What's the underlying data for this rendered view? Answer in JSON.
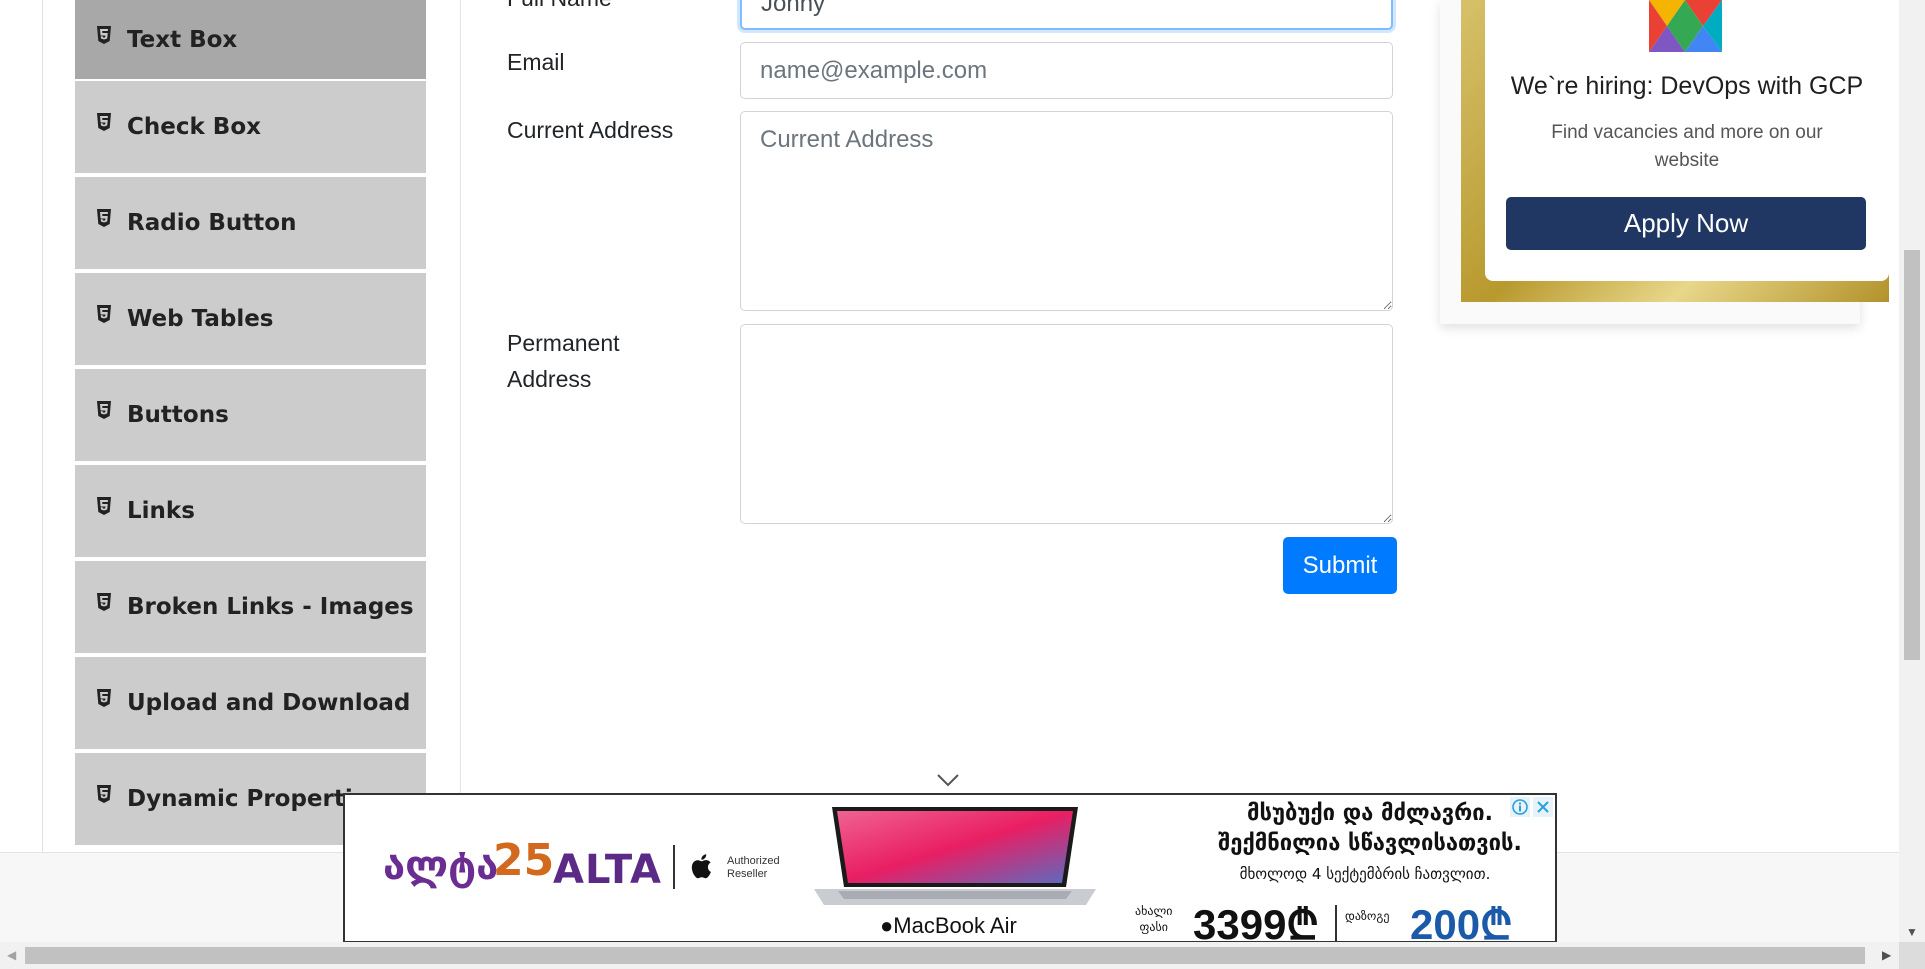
{
  "sidebar": {
    "items": [
      {
        "label": "Text Box",
        "active": true
      },
      {
        "label": "Check Box"
      },
      {
        "label": "Radio Button"
      },
      {
        "label": "Web Tables"
      },
      {
        "label": "Buttons"
      },
      {
        "label": "Links"
      },
      {
        "label": "Broken Links - Images"
      },
      {
        "label": "Upload and Download"
      },
      {
        "label": "Dynamic Properties"
      }
    ]
  },
  "form": {
    "full_name": {
      "label": "Full Name",
      "value": "Johny"
    },
    "email": {
      "label": "Email",
      "placeholder": "name@example.com"
    },
    "current_address": {
      "label": "Current Address",
      "placeholder": "Current Address"
    },
    "permanent_address": {
      "label_line1": "Permanent",
      "label_line2": "Address"
    },
    "submit_label": "Submit"
  },
  "ad_card": {
    "title": "We`re hiring: DevOps with GCP",
    "subtitle": "Find vacancies and more on our website",
    "button": "Apply Now"
  },
  "banner": {
    "brand_geo": "ალტა",
    "brand_25": "25",
    "brand_alta": "ALTA",
    "authorized": "Authorized",
    "reseller": "Reseller",
    "product": "MacBook Air",
    "headline_line1": "მსუბუქი და მძლავრი.",
    "headline_line2": "შექმნილია სწავლისათვის.",
    "note": "მხოლოდ 4 სექტემბრის ჩათვლით.",
    "new_price_line1": "ახალი",
    "new_price_line2": "ფასი",
    "price": "3399₾",
    "savings_label": "დაზოგე",
    "savings": "200₾"
  },
  "colors": {
    "primary": "#007bff",
    "menu_bg": "#cccccc",
    "menu_active": "#a8a8a8",
    "ad_button": "#203763"
  }
}
